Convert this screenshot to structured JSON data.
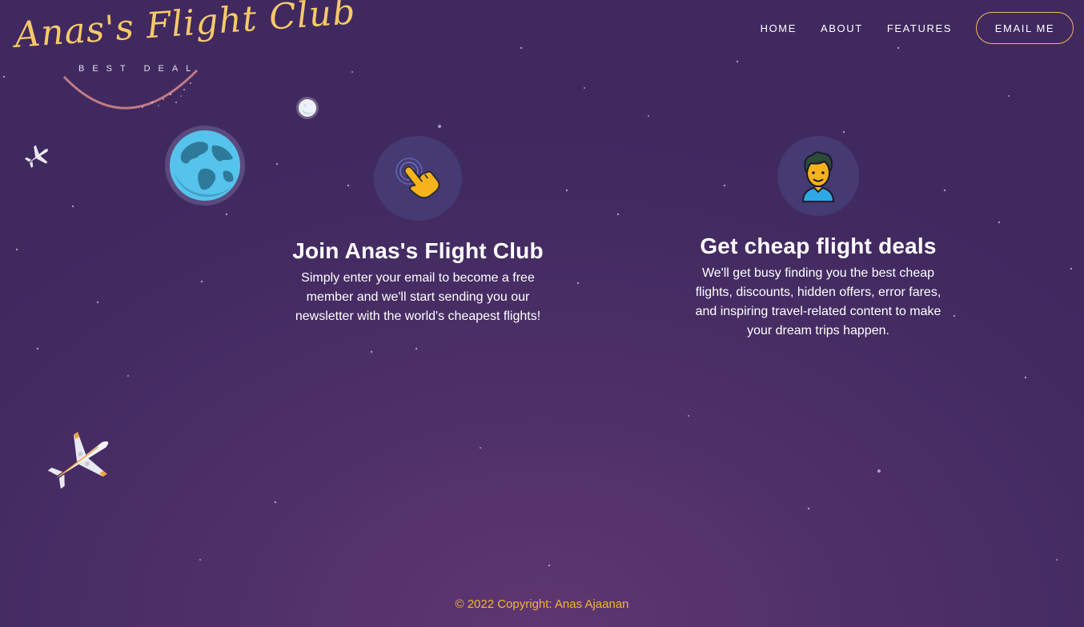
{
  "logo": {
    "title": "Anas's Flight Club",
    "tagline": "BEST DEAL"
  },
  "nav": {
    "links": [
      "HOME",
      "ABOUT",
      "FEATURES"
    ],
    "button": "EMAIL ME"
  },
  "features": [
    {
      "icon": "pointing-hand-icon",
      "title": "Join Anas's Flight Club",
      "text": "Simply enter your email to become a free member and we'll start sending you our newsletter with the world's cheapest flights!"
    },
    {
      "icon": "person-avatar-icon",
      "title": "Get cheap flight deals",
      "text": "We'll get busy finding you the best cheap flights, discounts, hidden offers, error fares, and inspiring travel-related content to make your dream trips happen."
    }
  ],
  "decorations": [
    "moon-icon",
    "earth-icon",
    "airplane-icon",
    "airplane-icon"
  ],
  "footer": {
    "text": "© 2022 Copyright: Anas Ajaanan"
  },
  "colors": {
    "accent": "#f4b95b",
    "footer": "#f3b43a",
    "background": "#452c63"
  }
}
